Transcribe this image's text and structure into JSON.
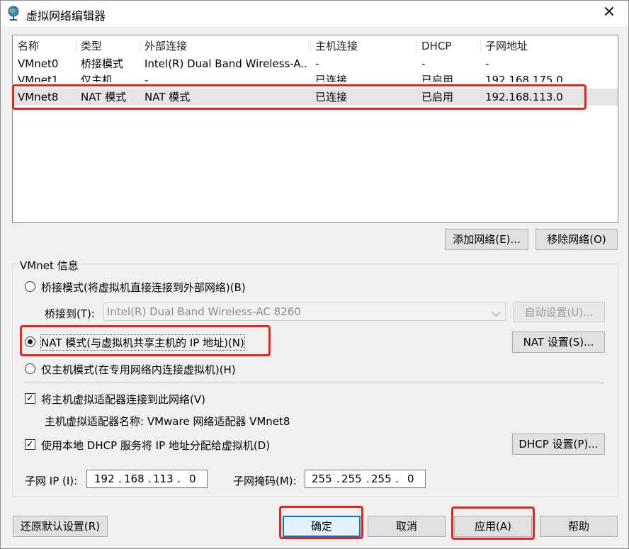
{
  "window": {
    "title": "虚拟网络编辑器",
    "close_glyph": "✕"
  },
  "table": {
    "headers": [
      "名称",
      "类型",
      "外部连接",
      "主机连接",
      "DHCP",
      "子网地址"
    ],
    "rows": [
      [
        "VMnet0",
        "桥接模式",
        "Intel(R) Dual Band Wireless-A...",
        "-",
        "-",
        "-"
      ],
      [
        "VMnet1",
        "仅主机",
        "-",
        "已连接",
        "已启用",
        "192.168.175.0"
      ],
      [
        "VMnet8",
        "NAT 模式",
        "NAT 模式",
        "已连接",
        "已启用",
        "192.168.113.0"
      ]
    ],
    "selected_row": 2
  },
  "buttons": {
    "add_network": "添加网络(E)...",
    "remove_network": "移除网络(O)",
    "auto_settings": "自动设置(U)...",
    "nat_settings": "NAT 设置(S)...",
    "dhcp_settings": "DHCP 设置(P)...",
    "restore_defaults": "还原默认设置(R)",
    "ok": "确定",
    "cancel": "取消",
    "apply": "应用(A)",
    "help": "帮助"
  },
  "vmnet_info": {
    "group_title": "VMnet 信息",
    "bridged_label": "桥接模式(将虚拟机直接连接到外部网络)(B)",
    "bridged_to_label": "桥接到(T):",
    "bridged_to_value": "Intel(R) Dual Band Wireless-AC 8260",
    "nat_label": "NAT 模式(与虚拟机共享主机的 IP 地址)(N)",
    "hostonly_label": "仅主机模式(在专用网络内连接虚拟机)(H)",
    "selected_mode": "nat",
    "connect_adapter_label": "将主机虚拟适配器连接到此网络(V)",
    "connect_adapter_checked": true,
    "adapter_name_label": "主机虚拟适配器名称: VMware 网络适配器 VMnet8",
    "use_dhcp_label": "使用本地 DHCP 服务将 IP 地址分配给虚拟机(D)",
    "use_dhcp_checked": true,
    "subnet_ip_label": "子网 IP (I):",
    "subnet_ip": [
      "192",
      "168",
      "113",
      "0"
    ],
    "subnet_mask_label": "子网掩码(M):",
    "subnet_mask": [
      "255",
      "255",
      "255",
      "0"
    ]
  },
  "colors": {
    "highlight": "#e8231b",
    "selected_row": "#e5e5e5",
    "window_bg": "#f0f0f0"
  }
}
